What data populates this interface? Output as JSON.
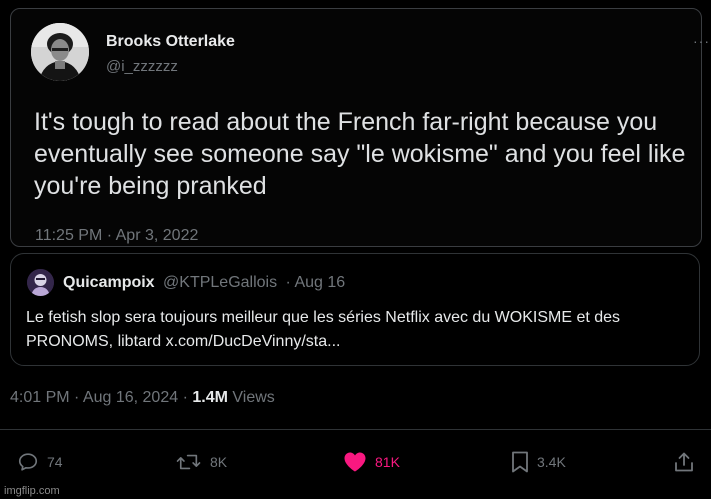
{
  "embedded_tweet": {
    "display_name": "Brooks Otterlake",
    "handle": "@i_zzzzzz",
    "more": "···",
    "text": "It's tough to read about the French far-right because you eventually see someone say \"le wokisme\" and you feel like you're being pranked",
    "timestamp": "11:25 PM · Apr 3, 2022"
  },
  "quoted_tweet": {
    "display_name": "Quicampoix",
    "handle": "@KTPLeGallois",
    "date": "· Aug 16",
    "text": "Le fetish slop sera toujours meilleur que les séries Netflix avec du WOKISME et des PRONOMS, libtard x.com/DucDeVinny/sta..."
  },
  "post_meta": {
    "timestamp": "4:01 PM · Aug 16, 2024 ·",
    "views_count": "1.4M",
    "views_label": "Views"
  },
  "actions": {
    "reply": {
      "icon": "reply-icon",
      "count": "74"
    },
    "repost": {
      "icon": "repost-icon",
      "count": "8K"
    },
    "like": {
      "icon": "heart-icon",
      "count": "81K",
      "color": "#f91880"
    },
    "bookmark": {
      "icon": "bookmark-icon",
      "count": "3.4K"
    },
    "share": {
      "icon": "share-icon"
    }
  },
  "watermark": "imgflip.com",
  "colors": {
    "background": "#000000",
    "text_primary": "#e7e9ea",
    "text_secondary": "#71767b",
    "border": "#2f3336",
    "like_active": "#f91880"
  }
}
